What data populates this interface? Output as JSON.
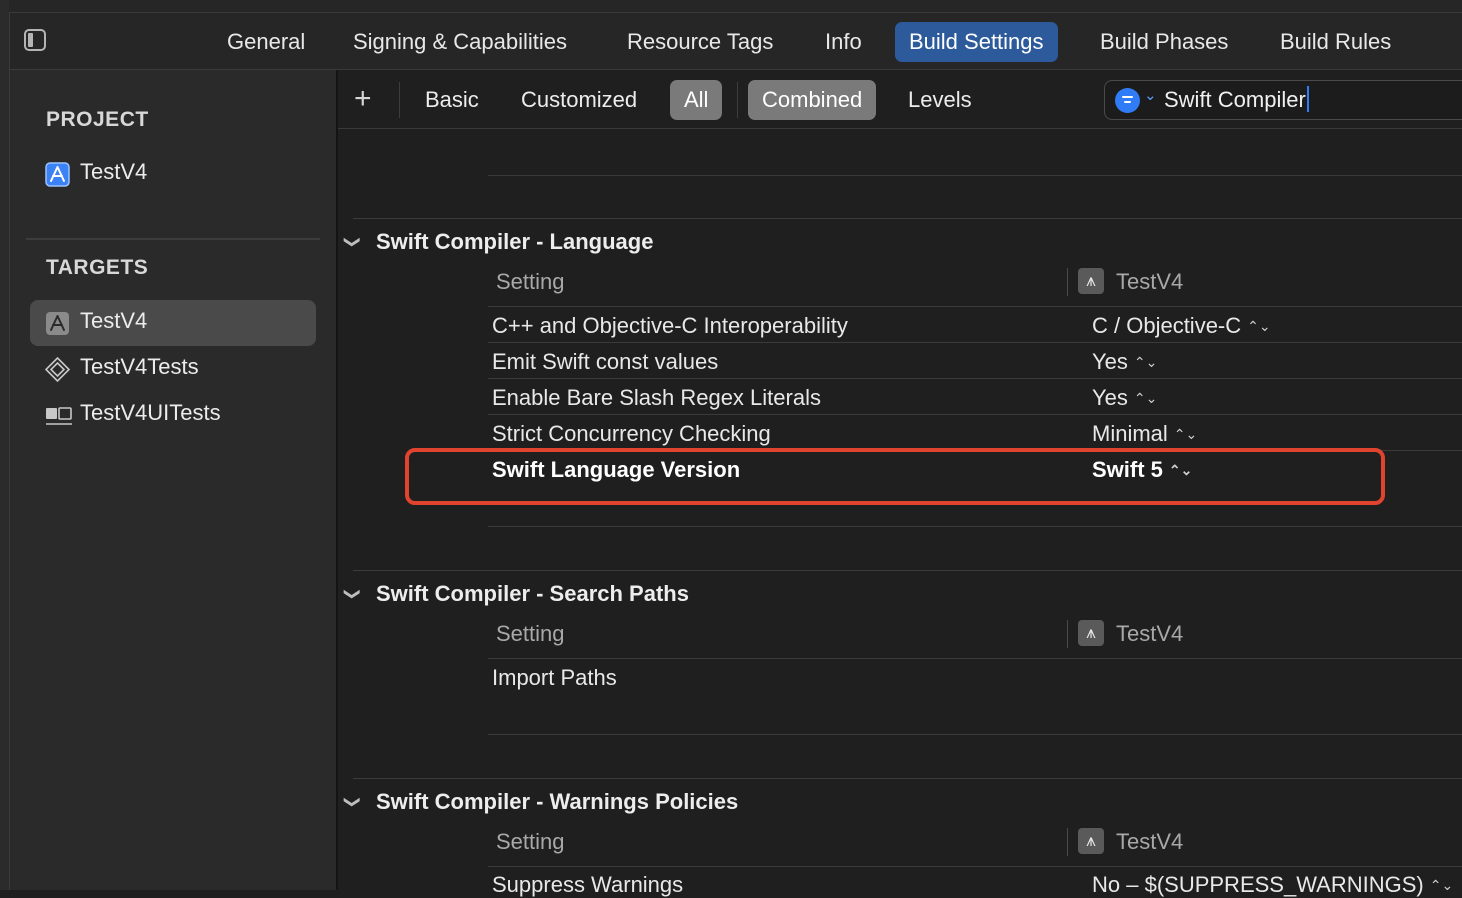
{
  "tabs": [
    "General",
    "Signing & Capabilities",
    "Resource Tags",
    "Info",
    "Build Settings",
    "Build Phases",
    "Build Rules"
  ],
  "active_tab": "Build Settings",
  "sidebar": {
    "project_header": "PROJECT",
    "project_items": [
      {
        "label": "TestV4",
        "icon": "app-project-icon"
      }
    ],
    "targets_header": "TARGETS",
    "target_items": [
      {
        "label": "TestV4",
        "icon": "app-target-icon",
        "selected": true
      },
      {
        "label": "TestV4Tests",
        "icon": "unit-test-target-icon"
      },
      {
        "label": "TestV4UITests",
        "icon": "ui-test-target-icon"
      }
    ]
  },
  "filterbar": {
    "add_label": "+",
    "basic": "Basic",
    "customized": "Customized",
    "all": "All",
    "combined": "Combined",
    "levels": "Levels",
    "search_value": "Swift Compiler"
  },
  "groups": {
    "language": {
      "title": "Swift Compiler - Language",
      "col_setting": "Setting",
      "col_target": "TestV4",
      "rows": [
        {
          "name": "C++ and Objective-C Interoperability",
          "value": "C / Objective-C"
        },
        {
          "name": "Emit Swift const values",
          "value": "Yes"
        },
        {
          "name": "Enable Bare Slash Regex Literals",
          "value": "Yes"
        },
        {
          "name": "Strict Concurrency Checking",
          "value": "Minimal"
        },
        {
          "name": "Swift Language Version",
          "value": "Swift 5"
        }
      ]
    },
    "search_paths": {
      "title": "Swift Compiler - Search Paths",
      "col_setting": "Setting",
      "col_target": "TestV4",
      "rows": [
        {
          "name": "Import Paths",
          "value": ""
        }
      ]
    },
    "warnings": {
      "title": "Swift Compiler - Warnings Policies",
      "col_setting": "Setting",
      "col_target": "TestV4",
      "rows": [
        {
          "name": "Suppress Warnings",
          "value": "No  –  $(SUPPRESS_WARNINGS)"
        }
      ]
    }
  },
  "colors": {
    "accent": "#2f7cf6",
    "active_tab": "#2d5a9a",
    "highlight_border": "#e0442f"
  }
}
